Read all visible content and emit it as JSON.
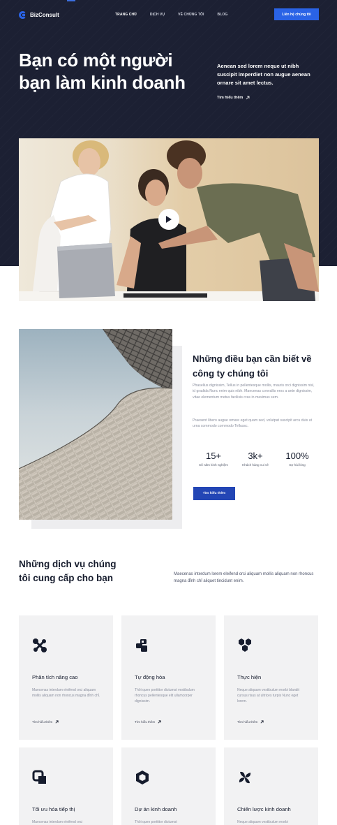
{
  "header": {
    "brand": "BizConsult",
    "menu": [
      "Trang chủ",
      "Dịch vụ",
      "Về chúng tôi",
      "Blog"
    ],
    "cta": "Liên hệ chúng tôi"
  },
  "hero": {
    "title": "Bạn có một người bạn làm kinh doanh",
    "side_text": "Aenean sed lorem neque ut nibh suscipit imperdiet non augue aenean ornare sit amet lectus.",
    "link": "Tìm hiểu thêm"
  },
  "about": {
    "title": "Những điều bạn cần biết về công ty chúng tôi",
    "para1": "Phasellus dignissim, Tellus in pellentesque mollis, mauris orci dignissim nisl, id gradida Nunc enim quis nibh. Maecenas convallis eros a ante dignissim, vitae elementum metus facilisis cras in maximus sem.",
    "para2": "Praesent libero augue ornare eget quam sed, volutpat suscipit arcu duis ut urna commodo commodo Tellussc.",
    "stats": [
      {
        "value": "15+",
        "label": "Số năm kinh nghiệm"
      },
      {
        "value": "3k+",
        "label": "Khách hàng vui vẻ"
      },
      {
        "value": "100%",
        "label": "Sự hài lòng"
      }
    ],
    "button": "Tìm hiểu thêm"
  },
  "services": {
    "title": "Những dịch vụ chúng tôi cung cấp cho bạn",
    "description": "Maecenas interdum lorem eleifend orci aliquam mollis aliquam non rhoncus magna đỉnh chỉ aliquet tincidunt enim.",
    "cards": [
      {
        "icon": "analytics-icon",
        "title": "Phân tích nâng cao",
        "text": "Maecenas interdum eleifend orci aliquam mollis aliquam non rhoncus magna đỉnh chỉ.",
        "link": "Tìm hiểu thêm"
      },
      {
        "icon": "automation-icon",
        "title": "Tự động hóa",
        "text": "Thôi quen porttitor dictumst vestibulum rhoncus pellentesque elit ullamcorper dignissim.",
        "link": "Tìm hiểu thêm"
      },
      {
        "icon": "execution-icon",
        "title": "Thực hiện",
        "text": "Neque aliquam vestibulum morbi blandit cursus risus at ultrices turpis Nunc eget lorem.",
        "link": "Tìm hiểu thêm"
      },
      {
        "icon": "marketing-icon",
        "title": "Tối ưu hóa tiếp thị",
        "text": "Maecenas interdum eleifend orci",
        "link": ""
      },
      {
        "icon": "project-icon",
        "title": "Dự án kinh doanh",
        "text": "Thôi quen porttitor dictumst",
        "link": ""
      },
      {
        "icon": "strategy-icon",
        "title": "Chiến lược kinh doanh",
        "text": "Neque aliquam vestibulum morbi",
        "link": ""
      }
    ]
  }
}
